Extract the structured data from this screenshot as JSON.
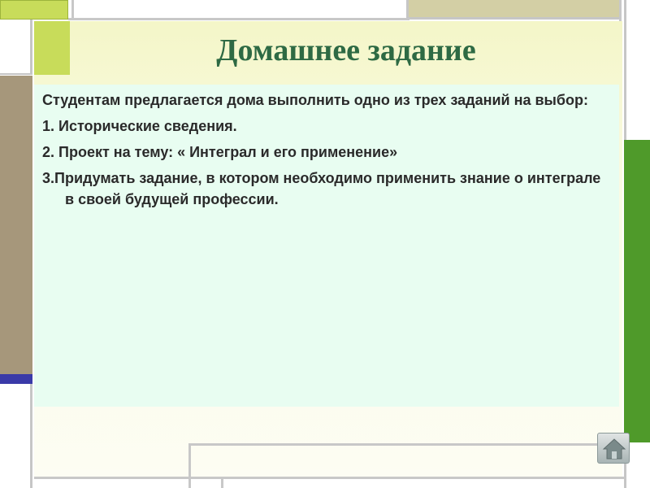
{
  "slide": {
    "title": "Домашнее задание",
    "paragraphs": [
      "Студентам предлагается дома выполнить одно из трех заданий на выбор:",
      "1. Исторические сведения.",
      "2. Проект на тему: « Интеграл и его применение»",
      "3.Придумать задание, в котором необходимо применить знание о интеграле в своей будущей профессии."
    ]
  },
  "navigation": {
    "home_icon": "home-icon"
  },
  "colors": {
    "title": "#2e6a44",
    "content_bg": "#e8fdf1",
    "accent_green": "#4f9a2a",
    "accent_lime": "#c8dc5a",
    "accent_tan": "#a6977b",
    "accent_blue": "#3a3aa8"
  }
}
